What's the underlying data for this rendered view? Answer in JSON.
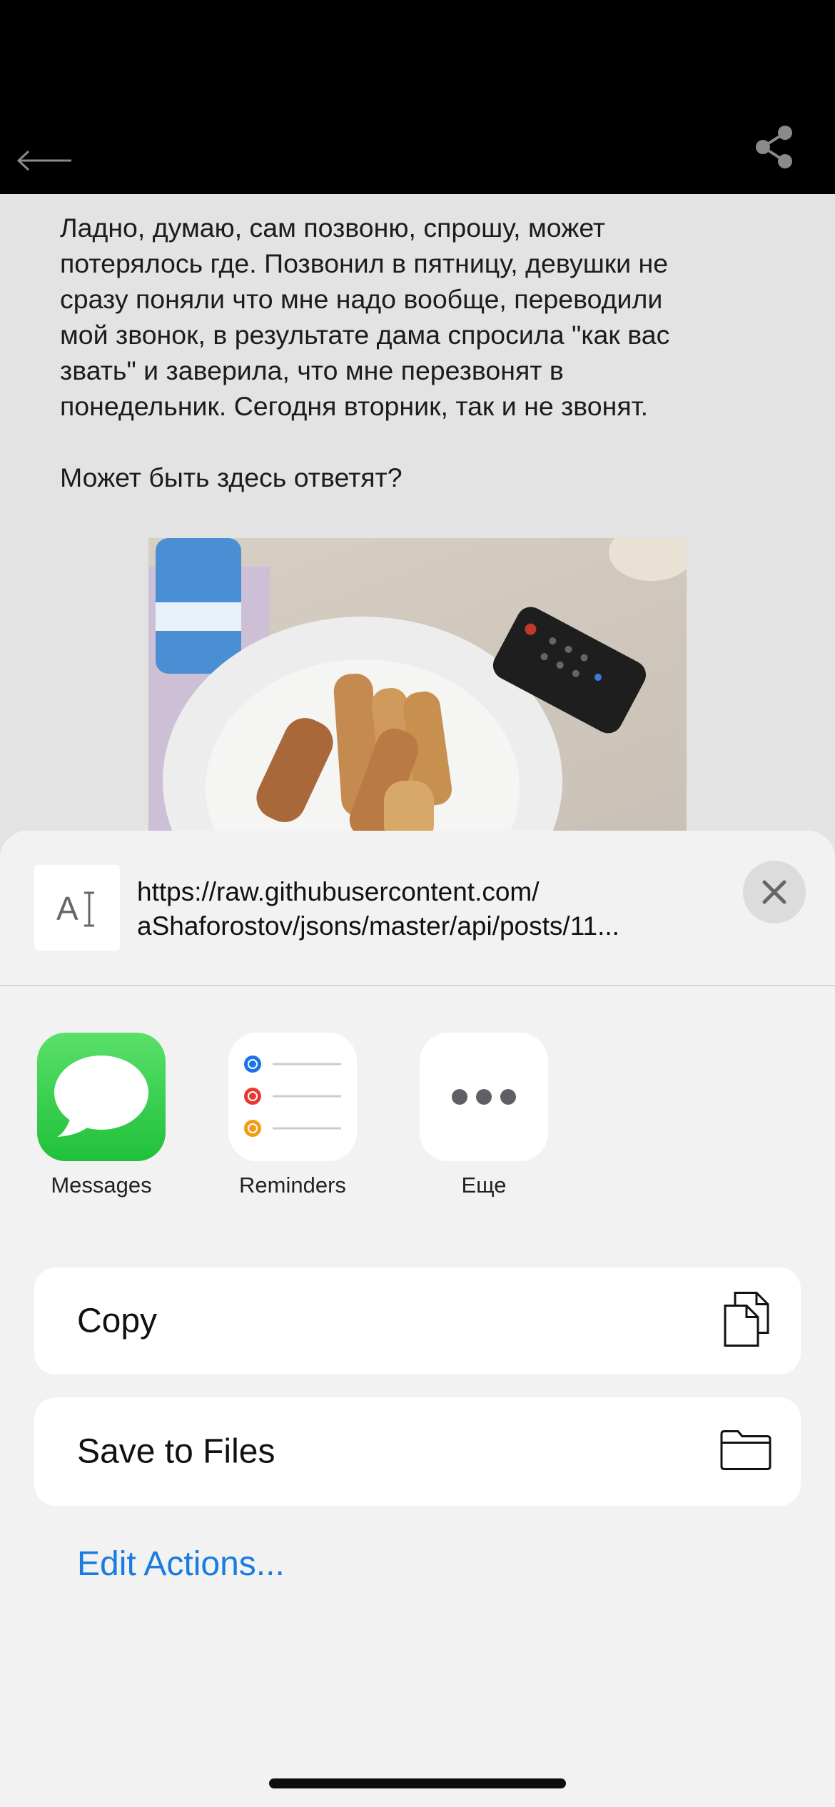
{
  "topbar": {
    "back_icon": "arrow-left-icon",
    "share_icon": "share-icon"
  },
  "post": {
    "text": "Ладно, думаю, сам позвоню, спрошу, может\nпотерялось где. Позвонил в пятницу, девушки не\nсразу поняли что мне надо вообще, переводили\nмой звонок, в результате дама спросила \"как вас\nзвать\" и заверила, что мне перезвонят в\nпонедельник. Сегодня вторник, так и не звонят.\n\nМожет быть здесь ответят?"
  },
  "share_sheet": {
    "url_line1": "https://raw.githubusercontent.com/",
    "url_line2": "aShaforostov/jsons/master/api/posts/11...",
    "apps": [
      {
        "label": "Messages",
        "icon": "messages-icon",
        "color": "#34c759"
      },
      {
        "label": "Reminders",
        "icon": "reminders-icon",
        "color": "#ffffff"
      },
      {
        "label": "Еще",
        "icon": "more-icon",
        "color": "#ffffff"
      }
    ],
    "actions": [
      {
        "label": "Copy",
        "icon": "copy-icon"
      },
      {
        "label": "Save to Files",
        "icon": "folder-icon"
      }
    ],
    "edit_actions": "Edit Actions..."
  },
  "colors": {
    "accent": "#1a7be0",
    "sheet_bg": "#f2f2f2",
    "topbar_bg": "#000000"
  }
}
